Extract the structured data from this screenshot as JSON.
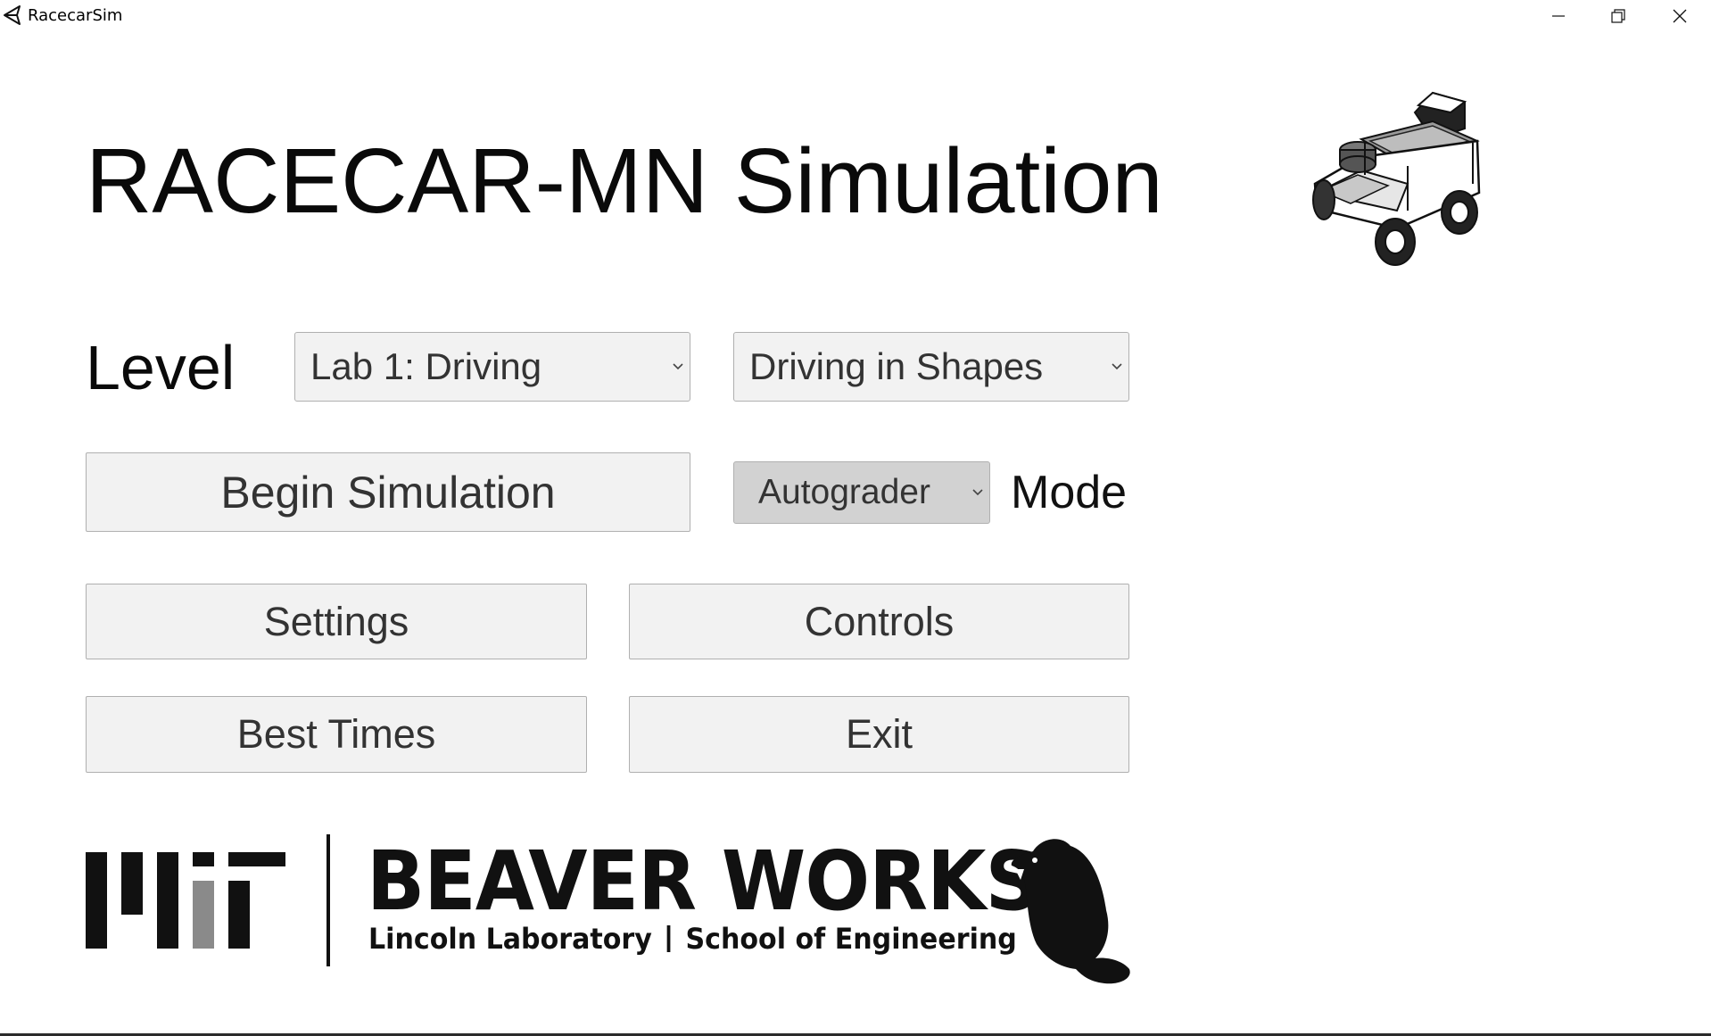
{
  "window": {
    "title": "RacecarSim",
    "icon": "unity-icon",
    "controls": [
      "minimize-icon",
      "restore-icon",
      "close-icon"
    ]
  },
  "main": {
    "title": "RACECAR-MN Simulation",
    "car_image": "racecar-illustration",
    "level_label": "Level",
    "lab_select": {
      "value": "Lab 1: Driving"
    },
    "activity_select": {
      "value": "Driving in Shapes"
    },
    "begin_button": "Begin Simulation",
    "mode_select": {
      "value": "Autograder"
    },
    "mode_label": "Mode",
    "settings_button": "Settings",
    "controls_button": "Controls",
    "best_times_button": "Best Times",
    "exit_button": "Exit"
  },
  "footer": {
    "logo": "mit-logo",
    "org_title": "BEAVER WORKS",
    "org_sub_left": "Lincoln Laboratory",
    "org_sub_right": "School of Engineering",
    "mascot": "beaver-icon"
  },
  "colors": {
    "background": "#ffffff",
    "button_bg": "#f2f2f2",
    "button_border": "#b0b0b0",
    "mode_select_bg": "#d2d2d2",
    "text": "#111111",
    "mit_gray": "#8a8a8a"
  }
}
